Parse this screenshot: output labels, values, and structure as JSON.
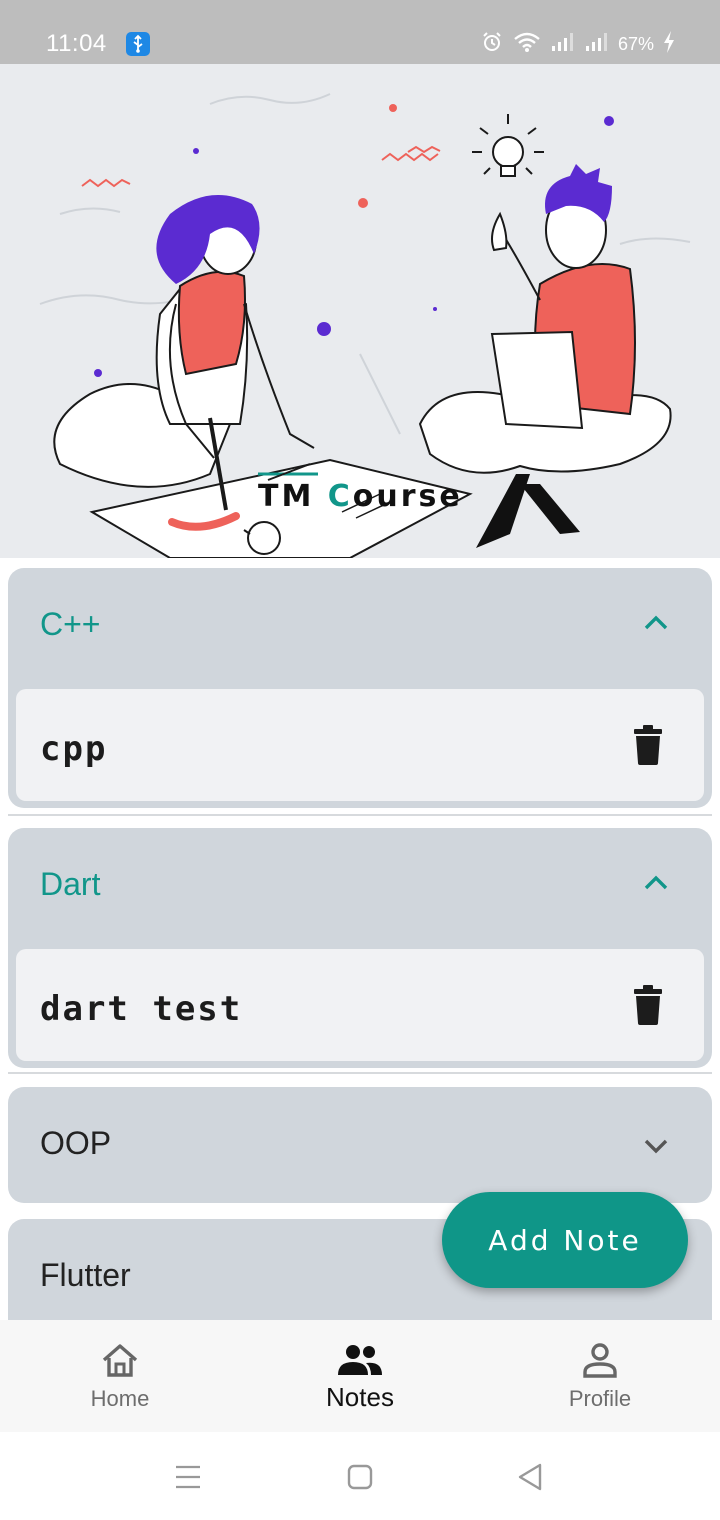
{
  "status_bar": {
    "time": "11:04",
    "battery": "67%",
    "icons": [
      "usb-icon",
      "alarm-icon",
      "wifi-icon",
      "signal-icon",
      "signal-icon",
      "charging-icon"
    ]
  },
  "hero": {
    "brand_tm": "TM ",
    "brand_c": "C",
    "brand_rest": "ourse"
  },
  "panels": [
    {
      "title": "C++",
      "expanded": true,
      "notes": [
        {
          "text": "cpp"
        }
      ]
    },
    {
      "title": "Dart",
      "expanded": true,
      "notes": [
        {
          "text": "dart test"
        }
      ]
    },
    {
      "title": "OOP",
      "expanded": false,
      "notes": []
    },
    {
      "title": "Flutter",
      "expanded": false,
      "notes": []
    }
  ],
  "fab": {
    "label": "Add Note"
  },
  "bottom_nav": {
    "items": [
      {
        "label": "Home",
        "icon": "home-icon",
        "active": false
      },
      {
        "label": "Notes",
        "icon": "people-icon",
        "active": true
      },
      {
        "label": "Profile",
        "icon": "person-icon",
        "active": false
      }
    ]
  },
  "system_nav": {
    "icons": [
      "recents-icon",
      "home-square-icon",
      "back-icon"
    ]
  },
  "colors": {
    "accent": "#0f9688",
    "panel": "#d0d6dc",
    "card": "#f1f2f4",
    "hero_bg": "#e9ebee",
    "figure_red": "#ee625a",
    "figure_purple": "#5b2bd1"
  }
}
